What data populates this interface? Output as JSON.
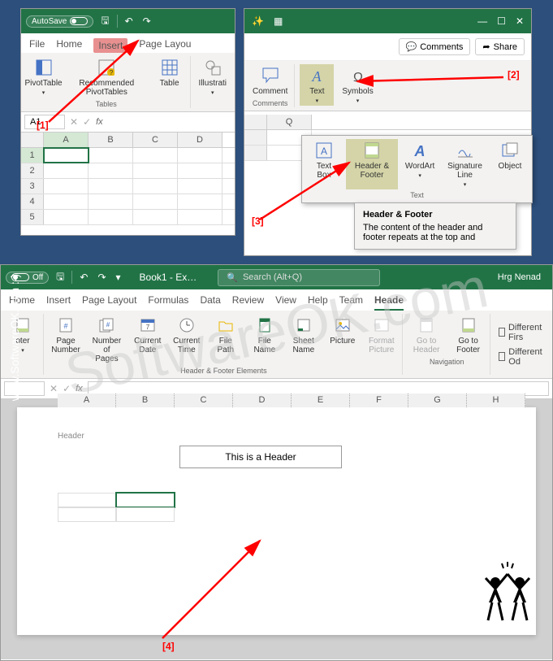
{
  "watermark": "SoftwareOK.com",
  "side_label": "www.SoftwareOK.com :-)",
  "markers": {
    "m1": "[1]",
    "m2": "[2]",
    "m3": "[3]",
    "m4": "[4]"
  },
  "panel1": {
    "autosave_label": "AutoSave",
    "tabs": {
      "file": "File",
      "home": "Home",
      "insert": "Insert",
      "page_layout": "Page Layou"
    },
    "ribbon": {
      "pivottable": "PivotTable",
      "recommended": "Recommended PivotTables",
      "table": "Table",
      "illustrations": "Illustrati",
      "group_tables": "Tables"
    },
    "namebox": "A1",
    "cols": [
      "A",
      "B",
      "C",
      "D"
    ],
    "rows": [
      "1",
      "2",
      "3",
      "4",
      "5"
    ]
  },
  "panel2": {
    "actions": {
      "comments": "Comments",
      "share": "Share"
    },
    "ribbon": {
      "comment": "Comment",
      "text": "Text",
      "symbols": "Symbols",
      "group_comments": "Comments"
    },
    "dropdown": {
      "textbox": "Text Box",
      "header_footer": "Header & Footer",
      "wordart": "WordArt",
      "signature": "Signature Line",
      "object": "Object",
      "group_text": "Text"
    },
    "tooltip": {
      "title": "Header & Footer",
      "body": "The content of the header and footer repeats at the top and"
    },
    "cols": [
      "Q"
    ]
  },
  "panel3": {
    "doc_title": "Book1 - Ex…",
    "search_placeholder": "Search (Alt+Q)",
    "user": "Hrg Nenad",
    "tabs": {
      "home": "Home",
      "insert": "Insert",
      "page_layout": "Page Layout",
      "formulas": "Formulas",
      "data": "Data",
      "review": "Review",
      "view": "View",
      "help": "Help",
      "team": "Team",
      "header": "Heade"
    },
    "ribbon": {
      "footer": "oter",
      "page_number": "Page Number",
      "num_pages": "Number of Pages",
      "current_date": "Current Date",
      "current_time": "Current Time",
      "file_path": "File Path",
      "file_name": "File Name",
      "sheet_name": "Sheet Name",
      "picture": "Picture",
      "format_picture": "Format Picture",
      "goto_header": "Go to Header",
      "goto_footer": "Go to Footer",
      "group_elements": "Header & Footer Elements",
      "group_nav": "Navigation",
      "diff_first": "Different Firs",
      "diff_odd": "Different Od"
    },
    "sheet": {
      "cols": [
        "A",
        "B",
        "C",
        "D",
        "E",
        "F",
        "G",
        "H"
      ],
      "header_label": "Header",
      "header_text": "This is a Header"
    }
  }
}
